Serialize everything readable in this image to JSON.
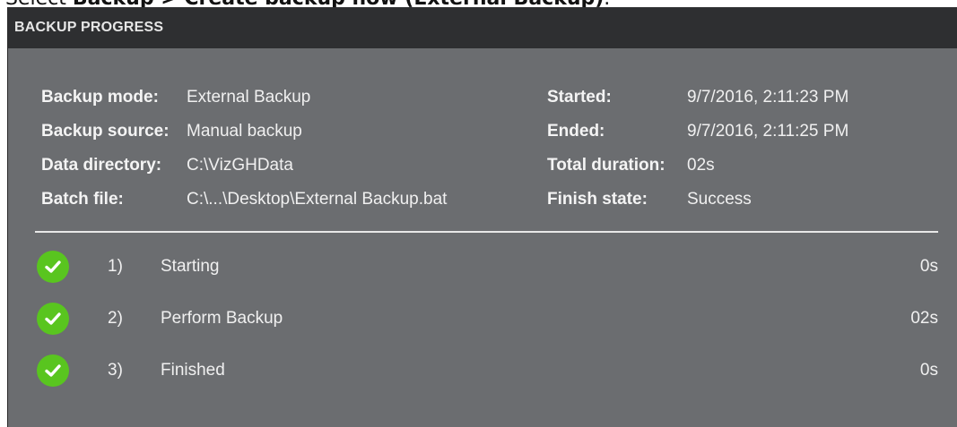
{
  "caption": {
    "prefix": "Select ",
    "path": "Backup > Create backup now (External Backup)",
    "suffix": "."
  },
  "dialog": {
    "title": "BACKUP PROGRESS"
  },
  "details": {
    "backup_mode": {
      "label": "Backup mode:",
      "value": "External Backup"
    },
    "backup_source": {
      "label": "Backup source:",
      "value": "Manual backup"
    },
    "data_directory": {
      "label": "Data directory:",
      "value": "C:\\VizGHData"
    },
    "batch_file": {
      "label": "Batch file:",
      "value": "C:\\...\\Desktop\\External Backup.bat"
    },
    "started": {
      "label": "Started:",
      "value": "9/7/2016, 2:11:23 PM"
    },
    "ended": {
      "label": "Ended:",
      "value": "9/7/2016, 2:11:25 PM"
    },
    "total_duration": {
      "label": "Total duration:",
      "value": "02s"
    },
    "finish_state": {
      "label": "Finish state:",
      "value": "Success"
    }
  },
  "steps": [
    {
      "number": "1)",
      "name": "Starting",
      "duration": "0s",
      "status": "success",
      "icon": "check-circle-icon"
    },
    {
      "number": "2)",
      "name": "Perform Backup",
      "duration": "02s",
      "status": "success",
      "icon": "check-circle-icon"
    },
    {
      "number": "3)",
      "name": "Finished",
      "duration": "0s",
      "status": "success",
      "icon": "check-circle-icon"
    }
  ],
  "colors": {
    "panel_bg": "#6b6d70",
    "titlebar_bg": "#2e2f31",
    "success_green": "#59c51f"
  }
}
